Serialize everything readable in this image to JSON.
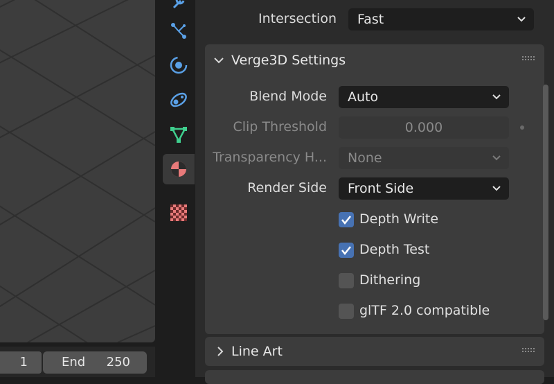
{
  "timeline": {
    "start_value": "1",
    "end_label": "End",
    "end_value": "250"
  },
  "tabs": [
    {
      "name": "wrench-icon"
    },
    {
      "name": "particles-icon"
    },
    {
      "name": "physics-icon"
    },
    {
      "name": "constraints-icon"
    },
    {
      "name": "object-data-icon"
    },
    {
      "name": "material-icon",
      "active": true
    },
    {
      "name": "texture-icon"
    }
  ],
  "intersection": {
    "label": "Intersection",
    "value": "Fast"
  },
  "verge3d": {
    "title": "Verge3D Settings",
    "blend_mode": {
      "label": "Blend Mode",
      "value": "Auto"
    },
    "clip_threshold": {
      "label": "Clip Threshold",
      "value": "0.000"
    },
    "transparency": {
      "label": "Transparency H...",
      "value": "None"
    },
    "render_side": {
      "label": "Render Side",
      "value": "Front Side"
    },
    "checkboxes": [
      {
        "label": "Depth Write",
        "checked": true
      },
      {
        "label": "Depth Test",
        "checked": true
      },
      {
        "label": "Dithering",
        "checked": false
      },
      {
        "label": "glTF 2.0 compatible",
        "checked": false
      }
    ]
  },
  "line_art": {
    "title": "Line Art"
  },
  "colors": {
    "accent": "#4772b3",
    "viewport": "#3d3d3d",
    "panel": "#3c3c3c"
  }
}
